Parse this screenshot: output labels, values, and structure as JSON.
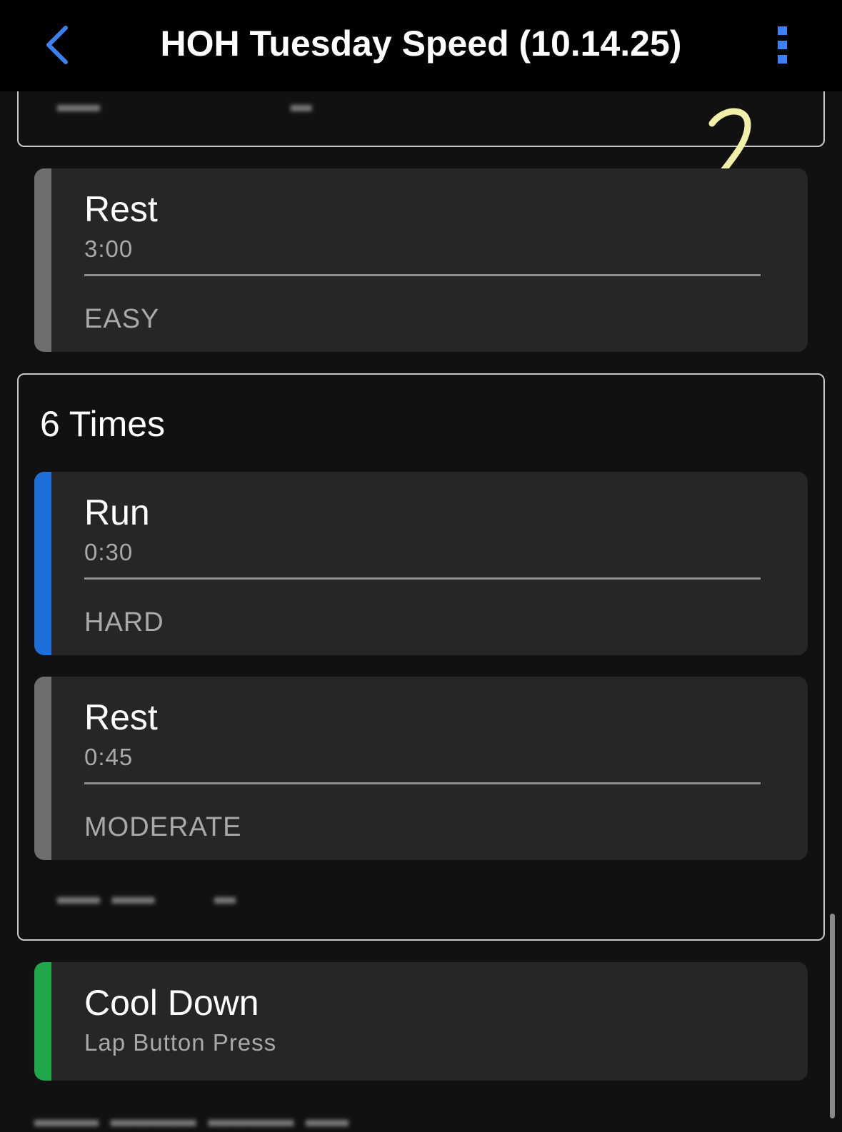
{
  "header": {
    "back_icon": "chevron-left-icon",
    "title": "HOH Tuesday Speed (10.14.25)",
    "menu_icon": "vertical-dots-icon",
    "accent_color": "#3b82f0"
  },
  "annotation": {
    "text": "2",
    "color": "#f2f0a8"
  },
  "steps": [
    {
      "name": "Rest",
      "duration": "3:00",
      "intensity": "EASY",
      "color": "#6e6e6e"
    }
  ],
  "repeat_group": {
    "title": "6 Times",
    "steps": [
      {
        "name": "Run",
        "duration": "0:30",
        "intensity": "HARD",
        "color": "#1e6fd9"
      },
      {
        "name": "Rest",
        "duration": "0:45",
        "intensity": "MODERATE",
        "color": "#6e6e6e"
      }
    ]
  },
  "cooldown": {
    "name": "Cool Down",
    "duration": "Lap Button Press",
    "color": "#1fa84a"
  }
}
